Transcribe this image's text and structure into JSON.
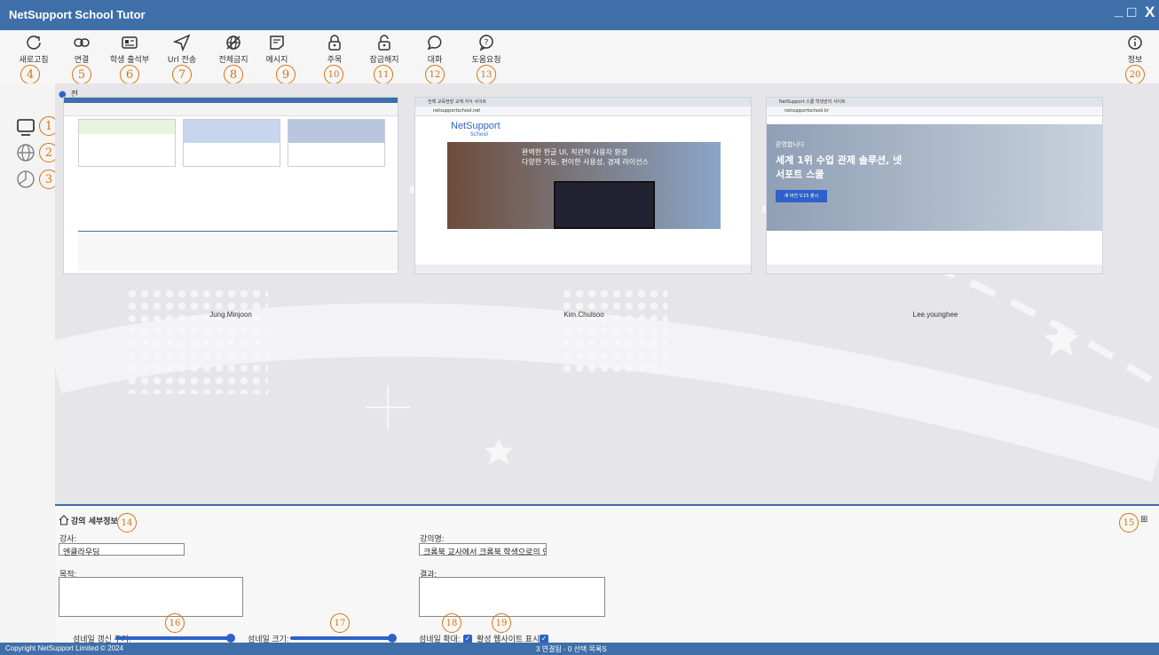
{
  "app": {
    "title": "NetSupport School Tutor",
    "min": "_",
    "max": "□",
    "close": "X"
  },
  "toolbar": [
    {
      "label": "새로고침",
      "icon": "refresh-icon",
      "num": "4"
    },
    {
      "label": "연결",
      "icon": "link-icon",
      "num": "5"
    },
    {
      "label": "학생 출석부",
      "icon": "id-card-icon",
      "num": "6"
    },
    {
      "label": "Url 전송",
      "icon": "send-icon",
      "num": "7"
    },
    {
      "label": "전체금지",
      "icon": "web-block-icon",
      "num": "8"
    },
    {
      "label": "메시지",
      "icon": "message-icon",
      "num": "9"
    },
    {
      "label": "주목",
      "icon": "lock-icon",
      "num": "10"
    },
    {
      "label": "잠금해지",
      "icon": "unlock-icon",
      "num": "11"
    },
    {
      "label": "대화",
      "icon": "chat-icon",
      "num": "12"
    },
    {
      "label": "도움요청",
      "icon": "help-icon",
      "num": "13"
    }
  ],
  "info": {
    "label": "정보",
    "num": "20"
  },
  "sidebar": {
    "nums": [
      "1",
      "2",
      "3"
    ]
  },
  "group": {
    "label": "전"
  },
  "thumbnails": [
    {
      "name": "Jung.Minjoon"
    },
    {
      "name": "Kim.Chulsoo",
      "browser_tab": "전체 교육현장 교재 지식 사이트",
      "url": "netsupportschool.net",
      "brand": "NetSupport",
      "brand_sub": "School",
      "banner1": "완벽한 한글 UI, 직관적 사용자 환경",
      "banner2": "다양한 기능, 편이한 사용성, 경제 라이선스"
    },
    {
      "name": "Lee.younghee",
      "browser_tab": "NetSupport 스쿨 학생관리 사이트",
      "url": "netsupportschool.kr",
      "banner_small": "환영합니다",
      "banner1": "세계 1위 수업 관제 솔루션, 넷",
      "banner2": "서포트 스쿨",
      "cta": "새 버전 V.15 출시"
    }
  ],
  "details": {
    "header": "강의 세부정보",
    "num": "14",
    "num_right": "15",
    "teacher_label": "강사:",
    "teacher_value": "엔클라우딩",
    "lecture_label": "강의명:",
    "lecture_value": "크롬북 교사에서 크롬북 학생으로의 연결",
    "purpose_label": "목적:",
    "result_label": "결과:"
  },
  "controls": {
    "refresh_label": "섬네일 갱신 주기:",
    "size_label": "섬네일 크기:",
    "zoom_label": "섬네일 확대:",
    "active_label": "활성 웹사이트 표시:",
    "nums": [
      "16",
      "17",
      "18",
      "19"
    ]
  },
  "status": {
    "copyright": "Copyright NetSupport Limited © 2024",
    "summary": "3 연결됨 - 0 선택 목록S"
  },
  "colors": {
    "titlebar": "#3f6fa9",
    "accent": "#2f61c9",
    "annotation": "#d9730c"
  }
}
